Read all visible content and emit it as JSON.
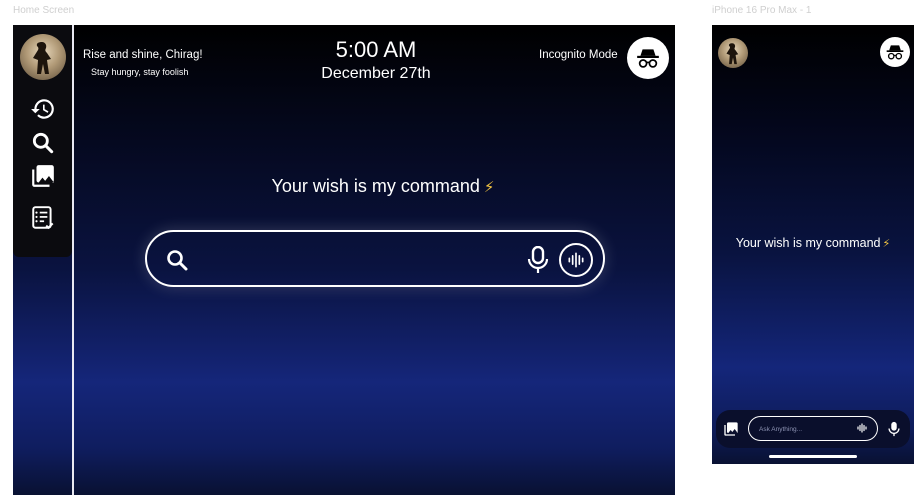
{
  "frames": {
    "desktop_label": "Home Screen",
    "phone_label": "iPhone 16 Pro Max - 1"
  },
  "desktop": {
    "greeting": "Rise and shine, Chirag!",
    "motto": "Stay hungry, stay foolish",
    "time": "5:00 AM",
    "date": "December 27th",
    "incognito_label": "Incognito Mode",
    "wish": "Your wish is my command",
    "wish_emoji": "⚡",
    "search": {
      "value": "",
      "placeholder": ""
    },
    "sidebar_icons": [
      "history-icon",
      "search-icon",
      "gallery-icon",
      "checklist-icon"
    ]
  },
  "phone": {
    "wish": "Your wish is my command",
    "wish_emoji": "⚡",
    "ask": {
      "value": "",
      "placeholder": "Ask Anything..."
    }
  },
  "colors": {
    "background_top": "#000000",
    "background_mid": "#0a1340",
    "background_glow": "#15267a",
    "accent_bolt": "#f4c542",
    "foreground": "#ffffff"
  }
}
